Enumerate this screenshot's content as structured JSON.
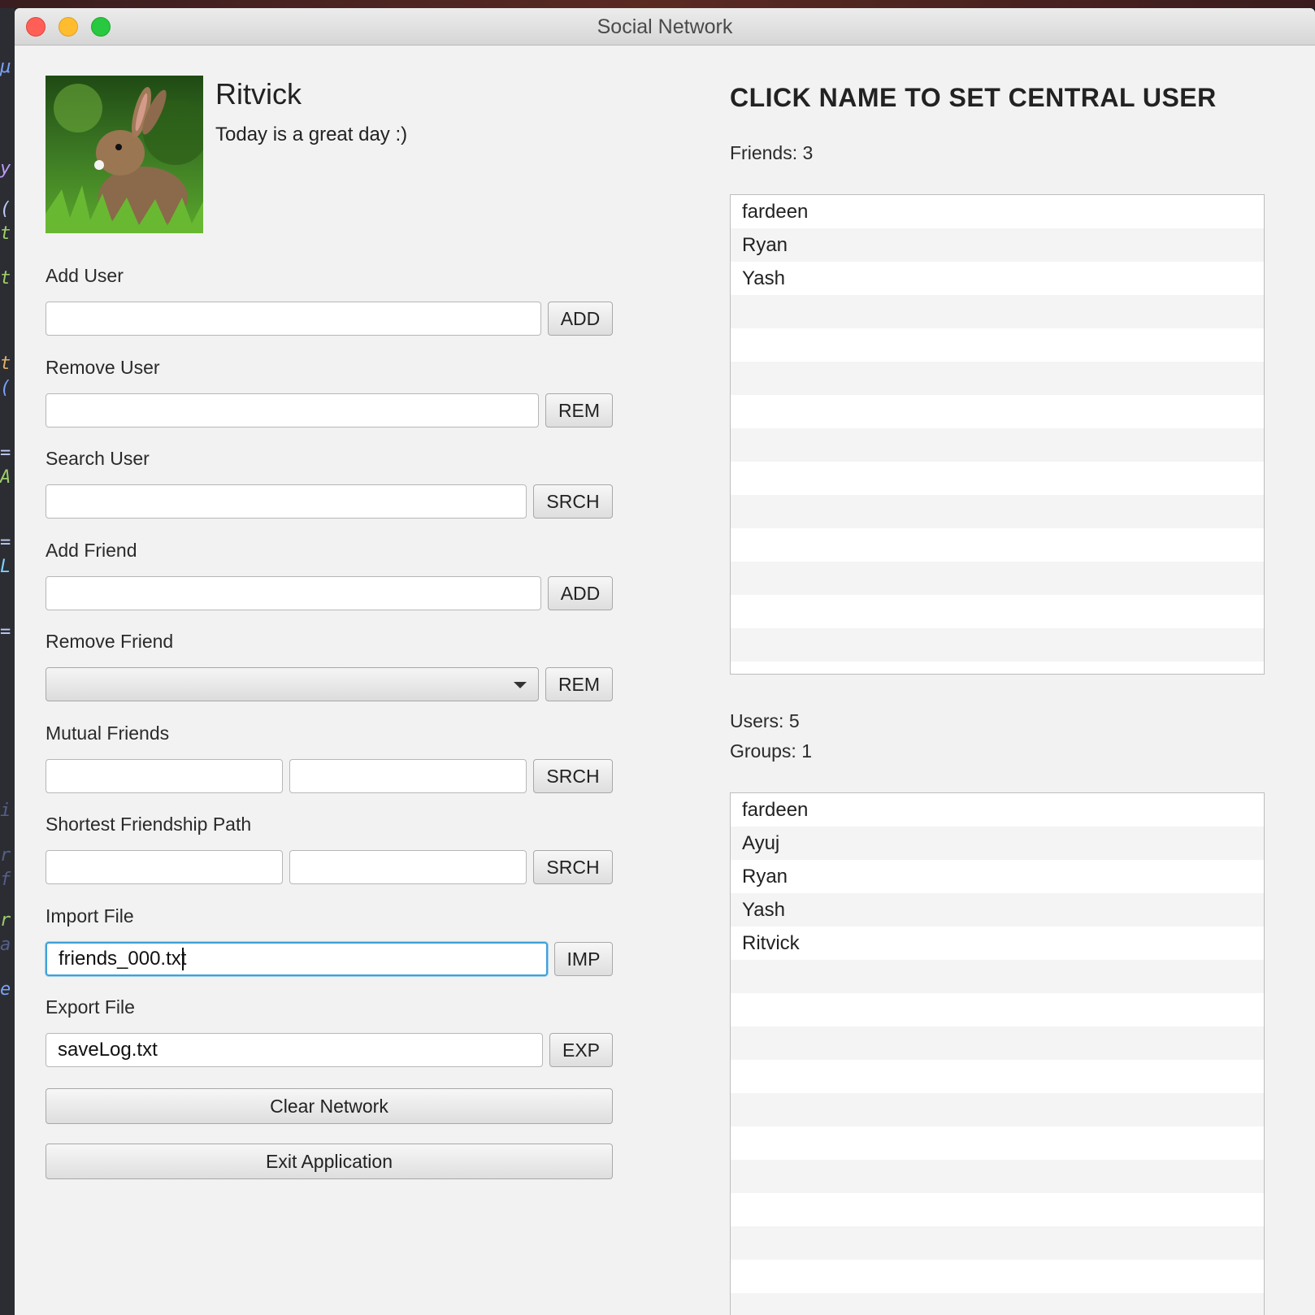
{
  "window": {
    "title": "Social Network"
  },
  "colors": {
    "accent_focus": "#3fa0d8",
    "close": "#ff5f57",
    "minimize": "#febc2e",
    "maximize": "#28c840"
  },
  "profile": {
    "name": "Ritvick",
    "status": "Today is a great day :)",
    "avatar": "rabbit-photo"
  },
  "form": {
    "add_user": {
      "label": "Add User",
      "value": "",
      "button": "ADD"
    },
    "remove_user": {
      "label": "Remove User",
      "value": "",
      "button": "REM"
    },
    "search_user": {
      "label": "Search User",
      "value": "",
      "button": "SRCH"
    },
    "add_friend": {
      "label": "Add Friend",
      "value": "",
      "button": "ADD"
    },
    "remove_friend": {
      "label": "Remove Friend",
      "selected": "",
      "button": "REM"
    },
    "mutual_friends": {
      "label": "Mutual Friends",
      "value1": "",
      "value2": "",
      "button": "SRCH"
    },
    "shortest_path": {
      "label": "Shortest Friendship Path",
      "value1": "",
      "value2": "",
      "button": "SRCH"
    },
    "import_file": {
      "label": "Import File",
      "value": "friends_000.txt",
      "button": "IMP"
    },
    "export_file": {
      "label": "Export File",
      "value": "saveLog.txt",
      "button": "EXP"
    },
    "clear_network": "Clear Network",
    "exit_application": "Exit Application"
  },
  "right_panel": {
    "heading": "CLICK NAME TO SET CENTRAL USER",
    "friends_count": "Friends: 3",
    "friends": [
      "fardeen",
      "Ryan",
      "Yash"
    ],
    "users_count": "Users: 5",
    "groups_count": "Groups: 1",
    "users": [
      "fardeen",
      "Ayuj",
      "Ryan",
      "Yash",
      "Ritvick"
    ]
  }
}
